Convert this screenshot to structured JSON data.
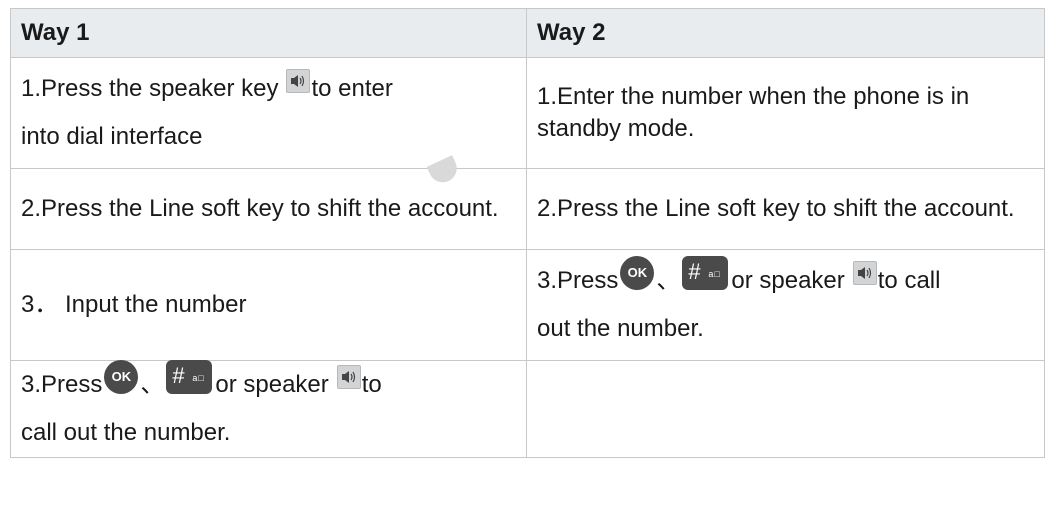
{
  "table": {
    "headers": [
      "Way 1",
      "Way 2"
    ],
    "row1": {
      "way1_a": "1.Press the speaker key",
      "way1_b": "to enter",
      "way1_c": "into dial interface",
      "way2": "1.Enter the number when the phone is in standby mode."
    },
    "row2": {
      "way1": "2.Press the Line soft key to shift the account.",
      "way2": "2.Press the Line soft key to shift the account."
    },
    "row3": {
      "way1": "3． Input the number",
      "way2_a": "3.Press",
      "way2_sep": "、",
      "way2_b": "or speaker",
      "way2_c": "to call",
      "way2_d": "out the number."
    },
    "row4": {
      "way1_a": "3.Press",
      "way1_sep": "、",
      "way1_b": "or speaker",
      "way1_c": "to",
      "way1_d": "call out the number."
    }
  },
  "keys": {
    "ok_label": "OK",
    "hash_label": "#",
    "hash_sub": "a□",
    "icons": [
      "speaker-key-icon",
      "ok-key-icon",
      "hash-key-icon"
    ]
  },
  "colors": {
    "header_bg": "#e9ecef",
    "border": "#c8c8c8",
    "key_dark": "#4a4a4a",
    "speaker_key": "#d2d4d6"
  }
}
